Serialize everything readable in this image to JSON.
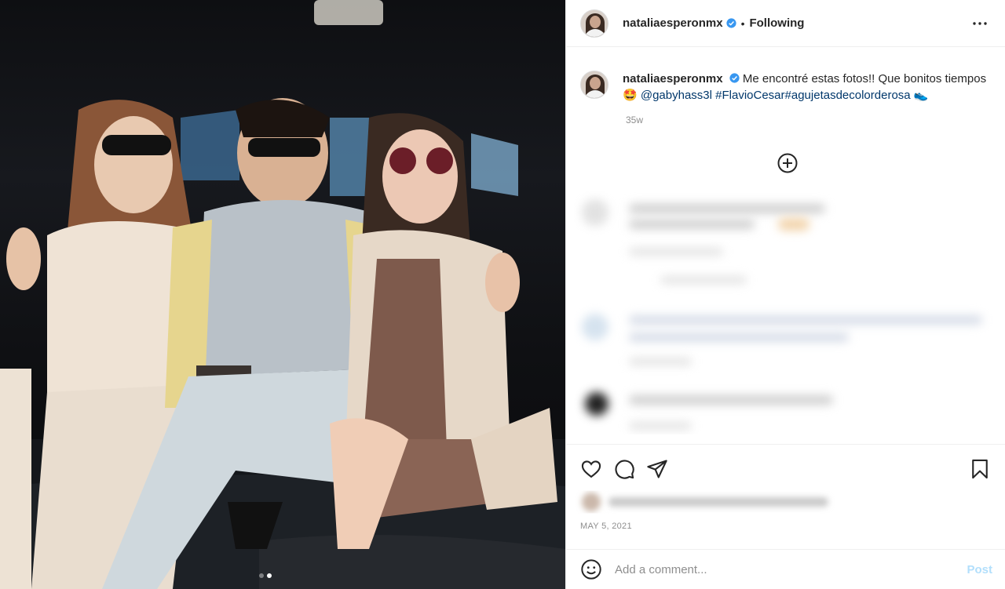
{
  "post": {
    "author": "nataliaesperonmx",
    "follow_status": "Following",
    "separator": "•",
    "caption_user": "nataliaesperonmx",
    "caption_text_1": "Me encontré estas fotos!! Que bonitos tiempos",
    "caption_emoji_1": "🤩",
    "caption_mention": "@gabyhass3l",
    "caption_tags": "#FlavioCesar#agujetasdecolorderosa",
    "caption_emoji_2": "👟",
    "caption_age": "35w",
    "date": "MAY 5, 2021"
  },
  "comment_box": {
    "placeholder": "Add a comment...",
    "post_label": "Post"
  },
  "icons": {
    "more": "more-options-icon",
    "like": "heart-icon",
    "comment": "comment-icon",
    "share": "share-icon",
    "save": "bookmark-icon",
    "emoji": "emoji-icon",
    "load_more": "plus-circle-icon",
    "verified": "verified-badge-icon"
  },
  "carousel": {
    "count": 2,
    "active": 2
  },
  "colors": {
    "link": "#00376b",
    "verified": "#3897f0",
    "post_disabled": "#b2dffc"
  }
}
